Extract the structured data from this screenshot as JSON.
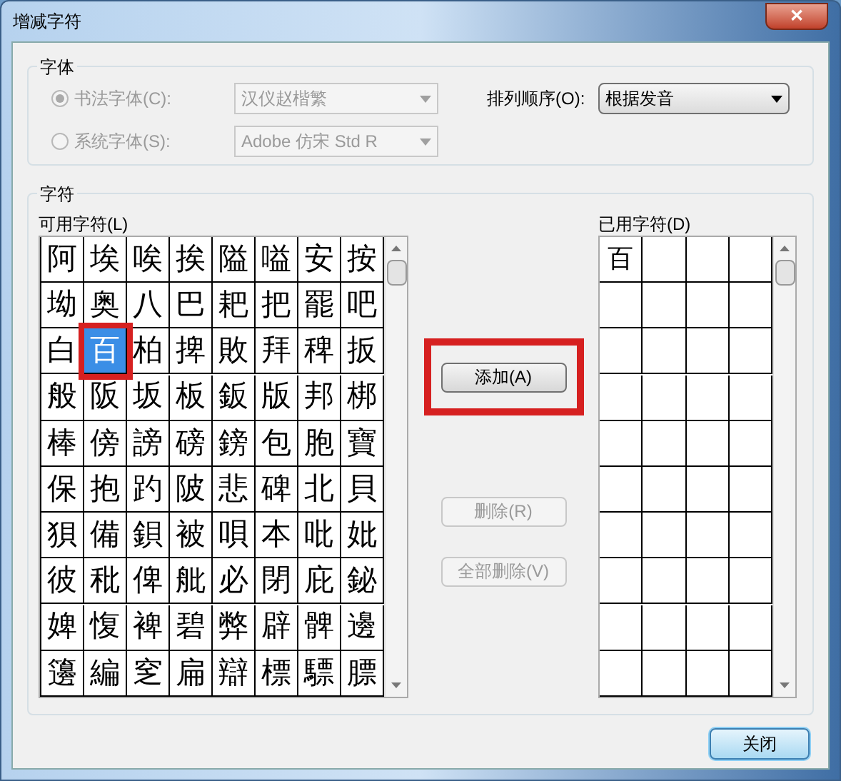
{
  "window": {
    "title": "增减字符",
    "close_symbol": "✕"
  },
  "font_group": {
    "title": "字体",
    "options": [
      {
        "label": "书法字体(C):",
        "selected": true,
        "font": "汉仪赵楷繁"
      },
      {
        "label": "系统字体(S):",
        "selected": false,
        "font": "Adobe 仿宋 Std R"
      }
    ],
    "disabled": true,
    "sort_label": "排列顺序(O):",
    "sort_value": "根据发音"
  },
  "chars_group": {
    "title": "字符",
    "available_label": "可用字符(L)",
    "used_label": "已用字符(D)",
    "available": [
      {
        "char": "阿",
        "selected": false
      },
      {
        "char": "埃",
        "selected": false
      },
      {
        "char": "唉",
        "selected": false
      },
      {
        "char": "挨",
        "selected": false
      },
      {
        "char": "隘",
        "selected": false
      },
      {
        "char": "嗌",
        "selected": false
      },
      {
        "char": "安",
        "selected": false
      },
      {
        "char": "按",
        "selected": false
      },
      {
        "char": "坳",
        "selected": false
      },
      {
        "char": "奥",
        "selected": false
      },
      {
        "char": "八",
        "selected": false
      },
      {
        "char": "巴",
        "selected": false
      },
      {
        "char": "耙",
        "selected": false
      },
      {
        "char": "把",
        "selected": false
      },
      {
        "char": "罷",
        "selected": false
      },
      {
        "char": "吧",
        "selected": false
      },
      {
        "char": "白",
        "selected": false
      },
      {
        "char": "百",
        "selected": true
      },
      {
        "char": "柏",
        "selected": false
      },
      {
        "char": "捭",
        "selected": false
      },
      {
        "char": "敗",
        "selected": false
      },
      {
        "char": "拜",
        "selected": false
      },
      {
        "char": "稗",
        "selected": false
      },
      {
        "char": "扳",
        "selected": false
      },
      {
        "char": "般",
        "selected": false
      },
      {
        "char": "阪",
        "selected": false
      },
      {
        "char": "坂",
        "selected": false
      },
      {
        "char": "板",
        "selected": false
      },
      {
        "char": "鈑",
        "selected": false
      },
      {
        "char": "版",
        "selected": false
      },
      {
        "char": "邦",
        "selected": false
      },
      {
        "char": "梆",
        "selected": false
      },
      {
        "char": "棒",
        "selected": false
      },
      {
        "char": "傍",
        "selected": false
      },
      {
        "char": "謗",
        "selected": false
      },
      {
        "char": "磅",
        "selected": false
      },
      {
        "char": "鎊",
        "selected": false
      },
      {
        "char": "包",
        "selected": false
      },
      {
        "char": "胞",
        "selected": false
      },
      {
        "char": "寶",
        "selected": false
      },
      {
        "char": "保",
        "selected": false
      },
      {
        "char": "抱",
        "selected": false
      },
      {
        "char": "趵",
        "selected": false
      },
      {
        "char": "陂",
        "selected": false
      },
      {
        "char": "悲",
        "selected": false
      },
      {
        "char": "碑",
        "selected": false
      },
      {
        "char": "北",
        "selected": false
      },
      {
        "char": "貝",
        "selected": false
      },
      {
        "char": "狽",
        "selected": false
      },
      {
        "char": "備",
        "selected": false
      },
      {
        "char": "鋇",
        "selected": false
      },
      {
        "char": "被",
        "selected": false
      },
      {
        "char": "唄",
        "selected": false
      },
      {
        "char": "本",
        "selected": false
      },
      {
        "char": "吡",
        "selected": false
      },
      {
        "char": "妣",
        "selected": false
      },
      {
        "char": "彼",
        "selected": false
      },
      {
        "char": "秕",
        "selected": false
      },
      {
        "char": "俾",
        "selected": false
      },
      {
        "char": "舭",
        "selected": false
      },
      {
        "char": "必",
        "selected": false
      },
      {
        "char": "閉",
        "selected": false
      },
      {
        "char": "庇",
        "selected": false
      },
      {
        "char": "鉍",
        "selected": false
      },
      {
        "char": "婢",
        "selected": false
      },
      {
        "char": "愎",
        "selected": false
      },
      {
        "char": "裨",
        "selected": false
      },
      {
        "char": "碧",
        "selected": false
      },
      {
        "char": "弊",
        "selected": false
      },
      {
        "char": "辟",
        "selected": false
      },
      {
        "char": "髀",
        "selected": false
      },
      {
        "char": "邊",
        "selected": false
      },
      {
        "char": "籩",
        "selected": false
      },
      {
        "char": "編",
        "selected": false
      },
      {
        "char": "窆",
        "selected": false
      },
      {
        "char": "扁",
        "selected": false
      },
      {
        "char": "辯",
        "selected": false
      },
      {
        "char": "標",
        "selected": false
      },
      {
        "char": "驃",
        "selected": false
      },
      {
        "char": "膘",
        "selected": false
      }
    ],
    "used": [
      "百"
    ],
    "buttons": [
      {
        "label": "添加(A)",
        "disabled": false,
        "highlighted": true
      },
      {
        "label": "删除(R)",
        "disabled": true,
        "highlighted": false
      },
      {
        "label": "全部删除(V)",
        "disabled": true,
        "highlighted": false
      }
    ]
  },
  "close_button": {
    "label": "关闭",
    "focused": true
  }
}
